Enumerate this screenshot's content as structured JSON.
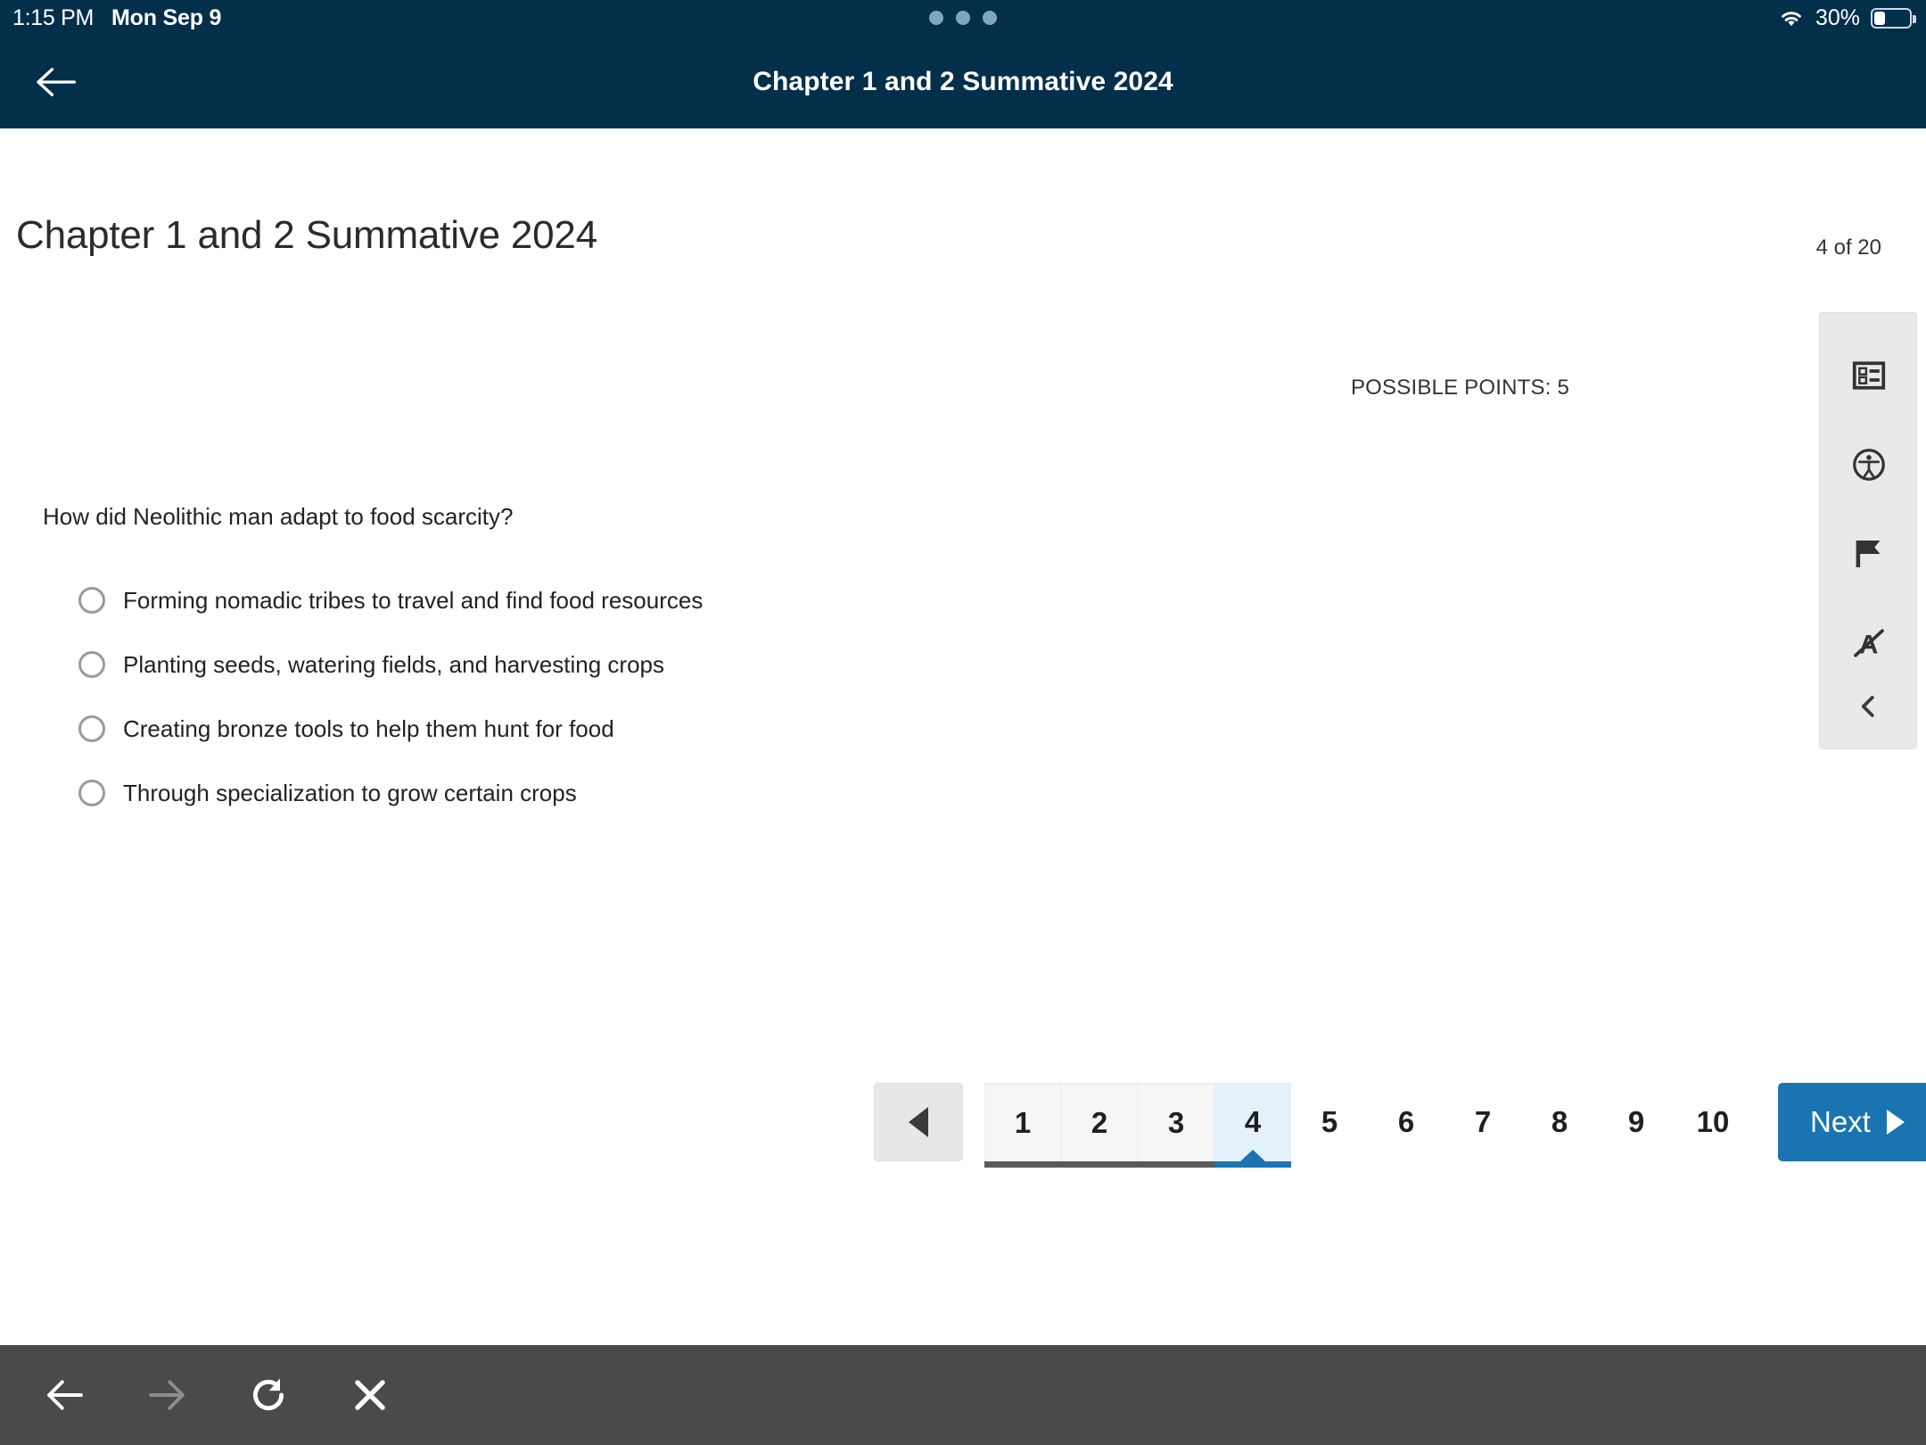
{
  "status_bar": {
    "time": "1:15 PM",
    "date": "Mon Sep 9",
    "battery_percent": "30%",
    "wifi_icon": "wifi-icon",
    "battery_icon": "battery-icon",
    "multitask_icon": "three-dots-icon"
  },
  "app_header": {
    "title": "Chapter 1 and 2 Summative 2024",
    "back_icon": "back-arrow-icon",
    "background_color": "#042F4B"
  },
  "assessment": {
    "page_title": "Chapter 1 and 2 Summative 2024",
    "question_counter": "4 of 20",
    "possible_points": "POSSIBLE POINTS: 5",
    "question_text": "How did Neolithic man adapt to food scarcity?",
    "options": [
      {
        "label": "Forming nomadic tribes to travel and find food resources",
        "selected": false
      },
      {
        "label": "Planting seeds, watering fields, and harvesting crops",
        "selected": false
      },
      {
        "label": "Creating bronze tools to help them hunt for food",
        "selected": false
      },
      {
        "label": "Through specialization to grow certain crops",
        "selected": false
      }
    ]
  },
  "tool_panel": {
    "tools": [
      {
        "icon": "question-list-icon"
      },
      {
        "icon": "accessibility-icon"
      },
      {
        "icon": "flag-icon"
      },
      {
        "icon": "strikethrough-answer-icon"
      }
    ],
    "collapse_icon": "chevron-left-icon",
    "background_color": "#e9e9e9"
  },
  "pagination": {
    "prev_icon": "triangle-left-icon",
    "pages": [
      {
        "label": "1",
        "state": "visited"
      },
      {
        "label": "2",
        "state": "visited"
      },
      {
        "label": "3",
        "state": "visited"
      },
      {
        "label": "4",
        "state": "current"
      },
      {
        "label": "5",
        "state": "unvisited"
      },
      {
        "label": "6",
        "state": "unvisited"
      },
      {
        "label": "7",
        "state": "unvisited"
      },
      {
        "label": "8",
        "state": "unvisited"
      },
      {
        "label": "9",
        "state": "unvisited"
      },
      {
        "label": "10",
        "state": "unvisited"
      }
    ],
    "next_label": "Next",
    "next_icon": "triangle-right-icon",
    "accent_color": "#1B74B2",
    "current_bg_color": "#e4f1fb"
  },
  "browser_toolbar": {
    "buttons": [
      {
        "icon": "arrow-left-icon",
        "enabled": true
      },
      {
        "icon": "arrow-right-icon",
        "enabled": false
      },
      {
        "icon": "reload-icon",
        "enabled": true
      },
      {
        "icon": "close-icon",
        "enabled": true
      }
    ],
    "background_color": "#4a4a4a"
  }
}
